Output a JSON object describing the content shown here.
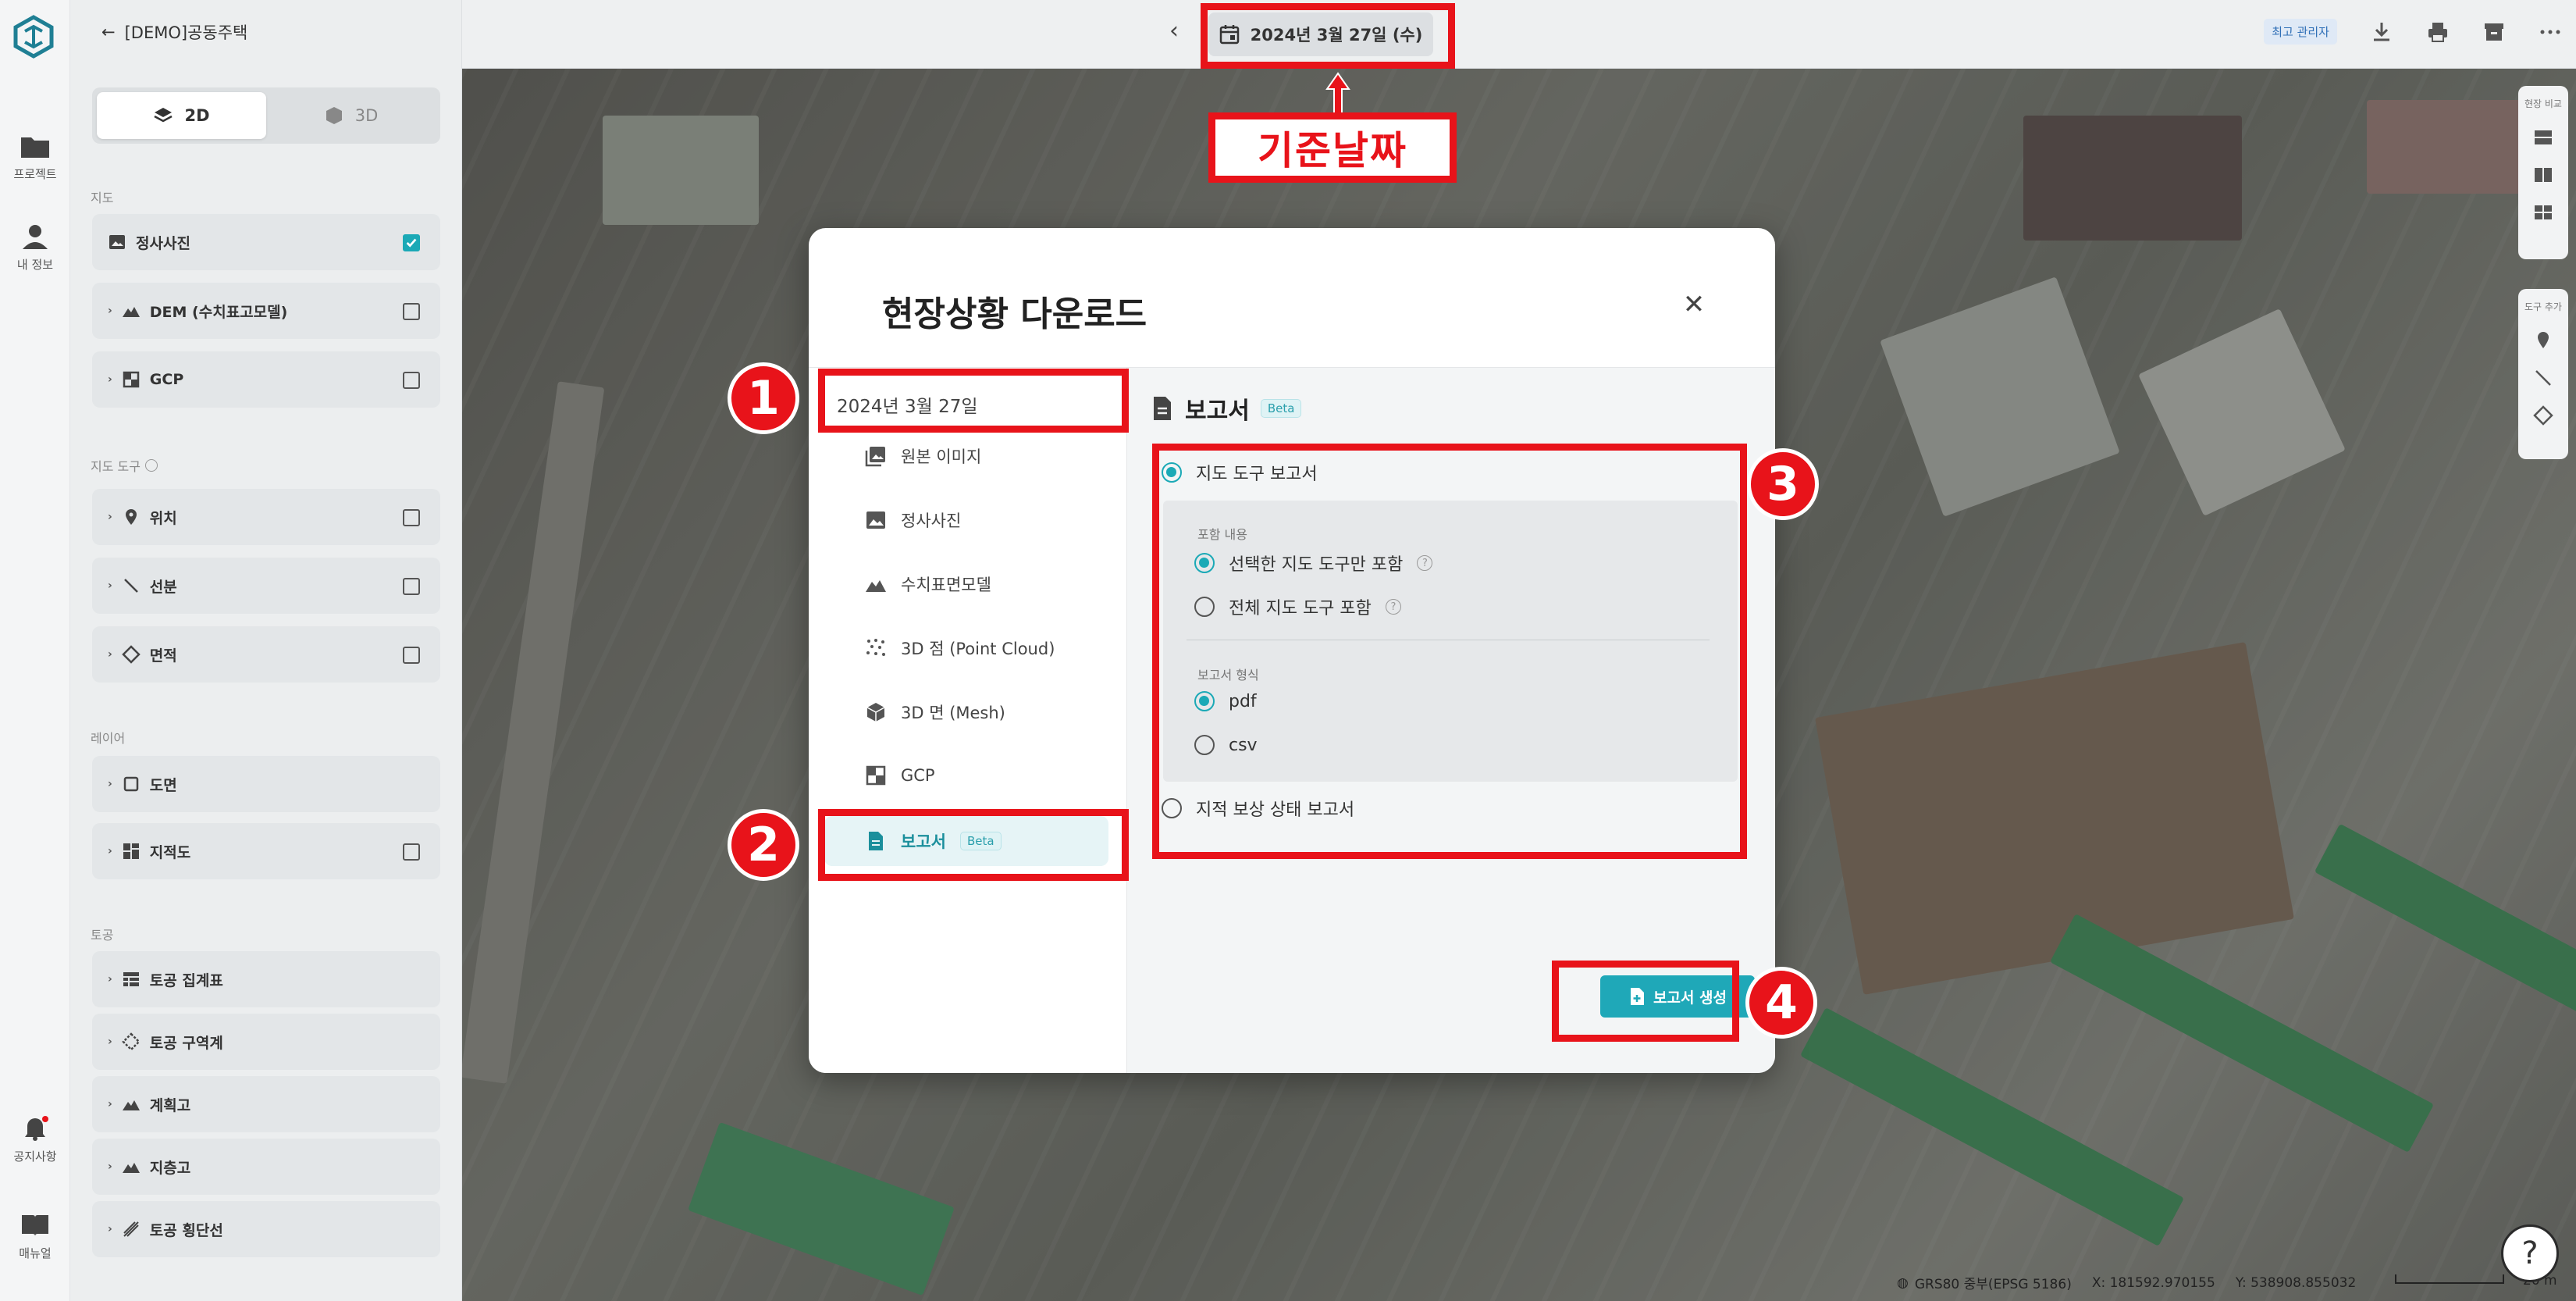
{
  "rail": {
    "items": [
      {
        "label": "프로젝트"
      },
      {
        "label": "내 정보"
      },
      {
        "label": "공지사항"
      },
      {
        "label": "매뉴얼"
      }
    ]
  },
  "panel": {
    "back_title": "[DEMO]공동주택",
    "view_toggle": {
      "option_2d": "2D",
      "option_3d": "3D",
      "selected": "2D"
    },
    "map_section": {
      "title": "지도",
      "layers": [
        {
          "label": "정사사진",
          "checked": true
        },
        {
          "label": "DEM (수치표고모델)",
          "checked": false
        },
        {
          "label": "GCP",
          "checked": false
        }
      ]
    },
    "tools_section": {
      "title": "지도 도구",
      "items": [
        {
          "label": "위치",
          "checked": false
        },
        {
          "label": "선분",
          "checked": false
        },
        {
          "label": "면적",
          "checked": false
        }
      ]
    },
    "layer_section": {
      "title": "레이어",
      "items": [
        {
          "label": "도면"
        },
        {
          "label": "지적도",
          "checked": false
        }
      ]
    },
    "earth_section": {
      "title": "토공",
      "items": [
        {
          "label": "토공 집계표"
        },
        {
          "label": "토공 구역계"
        },
        {
          "label": "계획고"
        },
        {
          "label": "지층고"
        },
        {
          "label": "토공 횡단선"
        }
      ]
    }
  },
  "topbar": {
    "date": "2024년 3월 27일 (수)",
    "role_badge": "최고 관리자"
  },
  "right_tools": {
    "compare_label": "현장 비교",
    "tools_label": "도구 추가"
  },
  "modal": {
    "title": "현장상황 다운로드",
    "date": "2024년 3월 27일",
    "menu": [
      {
        "label": "원본 이미지",
        "icon": "image-stack-icon"
      },
      {
        "label": "정사사진",
        "icon": "image-icon"
      },
      {
        "label": "수치표면모델",
        "icon": "terrain-icon"
      },
      {
        "label": "3D 점 (Point Cloud)",
        "icon": "point-cloud-icon"
      },
      {
        "label": "3D 면 (Mesh)",
        "icon": "cube-icon"
      },
      {
        "label": "GCP",
        "icon": "gcp-icon"
      },
      {
        "label": "보고서",
        "icon": "document-icon",
        "badge": "Beta",
        "selected": true
      }
    ],
    "section_title": "보고서",
    "section_badge": "Beta",
    "report_types": [
      {
        "label": "지도 도구 보고서",
        "selected": true
      },
      {
        "label": "지적 보상 상태 보고서",
        "selected": false
      }
    ],
    "include_label": "포함 내용",
    "include_options": [
      {
        "label": "선택한 지도 도구만 포함",
        "selected": true
      },
      {
        "label": "전체 지도 도구 포함",
        "selected": false
      }
    ],
    "format_label": "보고서 형식",
    "format_options": [
      {
        "label": "pdf",
        "selected": true
      },
      {
        "label": "csv",
        "selected": false
      }
    ],
    "generate_button": "보고서 생성"
  },
  "map": {
    "coords": {
      "crs": "GRS80 중부(EPSG 5186)",
      "x": "X: 181592.970155",
      "y": "Y: 538908.855032"
    },
    "scale": "20 m"
  },
  "annotations": {
    "callout": "기준날짜",
    "numbers": [
      "1",
      "2",
      "3",
      "4"
    ]
  },
  "colors": {
    "accent": "#1ba9b6",
    "annotation_red": "#e8131a"
  }
}
